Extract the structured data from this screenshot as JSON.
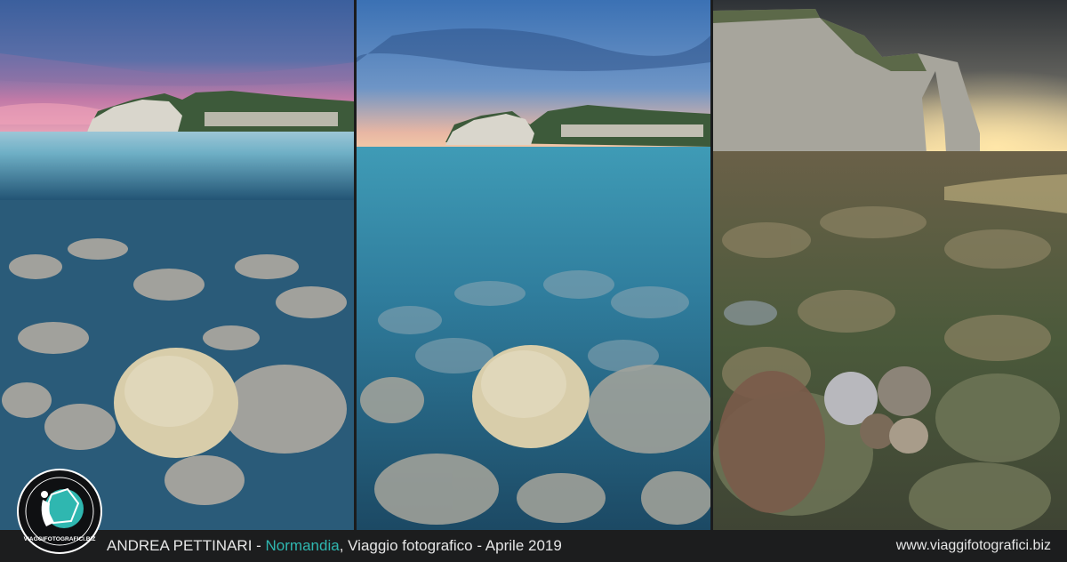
{
  "footer": {
    "photographer": "ANDREA PETTINARI",
    "separator": " - ",
    "location": "Normandia",
    "trip": ", Viaggio fotografico - Aprile 2019",
    "website": "www.viaggifotografici.biz"
  },
  "logo": {
    "text": "VIAGGIFOTOGRAFICI.BIZ"
  },
  "colors": {
    "accent": "#2fb7b0",
    "footer_bg": "#1c1d1e"
  }
}
